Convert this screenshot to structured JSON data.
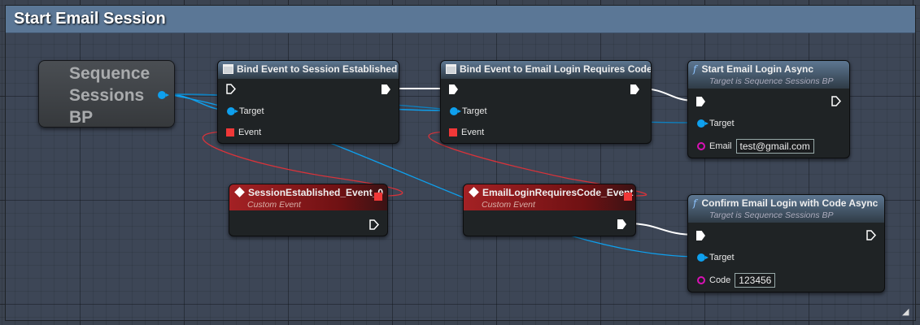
{
  "comment": {
    "title": "Start Email Session"
  },
  "variable_node": {
    "label": "Sequence Sessions BP"
  },
  "nodes": {
    "bind_session": {
      "title": "Bind Event to Session Established",
      "pins": [
        "Target",
        "Event"
      ]
    },
    "bind_email": {
      "title": "Bind Event to Email Login Requires Code",
      "pins": [
        "Target",
        "Event"
      ]
    },
    "start_login": {
      "title": "Start Email Login Async",
      "subtitle": "Target is Sequence Sessions BP",
      "pins": [
        "Target",
        "Email"
      ],
      "email_value": "test@gmail.com"
    },
    "session_event": {
      "title": "SessionEstablished_Event_0",
      "subtitle": "Custom Event"
    },
    "email_event": {
      "title": "EmailLoginRequiresCode_Event",
      "subtitle": "Custom Event"
    },
    "confirm_login": {
      "title": "Confirm Email Login with Code Async",
      "subtitle": "Target is Sequence Sessions BP",
      "pins": [
        "Target",
        "Code"
      ],
      "code_value": "123456"
    }
  },
  "colors": {
    "exec": "#ffffff",
    "object": "#0ea0ee",
    "delegate": "#f03838",
    "string": "#d911b5",
    "comment_header": "#5b7796",
    "event_header": "#a42124"
  }
}
